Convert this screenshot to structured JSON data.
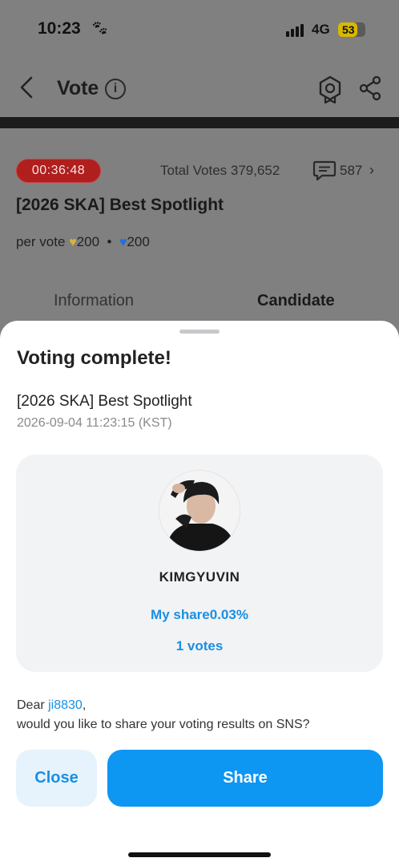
{
  "status_bar": {
    "time": "10:23",
    "network": "4G",
    "battery": "53"
  },
  "header": {
    "title": "Vote"
  },
  "poll": {
    "timer": "00:36:48",
    "total_votes_label": "Total Votes 379,652",
    "comments_count": "587",
    "title": "[2026 SKA] Best Spotlight",
    "per_vote_label": "per vote",
    "gold_cost": "200",
    "blue_cost": "200",
    "separator": "•"
  },
  "tabs": [
    {
      "label": "Information"
    },
    {
      "label": "Candidate"
    }
  ],
  "sheet": {
    "title": "Voting complete!",
    "poll_title": "[2026 SKA] Best Spotlight",
    "timestamp": "2026-09-04 11:23:15 (KST)",
    "candidate_name": "KIMGYUVIN",
    "my_share": "My share0.03%",
    "votes": "1 votes",
    "dear_prefix": "Dear ",
    "username": "ji8830",
    "dear_suffix": ",",
    "share_question": "would you like to share your voting results on SNS?",
    "close_label": "Close",
    "share_label": "Share"
  },
  "colors": {
    "accent": "#0e96f3",
    "timer_bg": "#b01e1e",
    "gold_heart": "#d7b43a",
    "blue_heart": "#1f6fe0"
  },
  "icons": [
    "back-chevron-icon",
    "info-icon",
    "badge-icon",
    "share-icon",
    "comment-icon",
    "chevron-right-icon",
    "gold-heart-icon",
    "blue-heart-icon"
  ]
}
